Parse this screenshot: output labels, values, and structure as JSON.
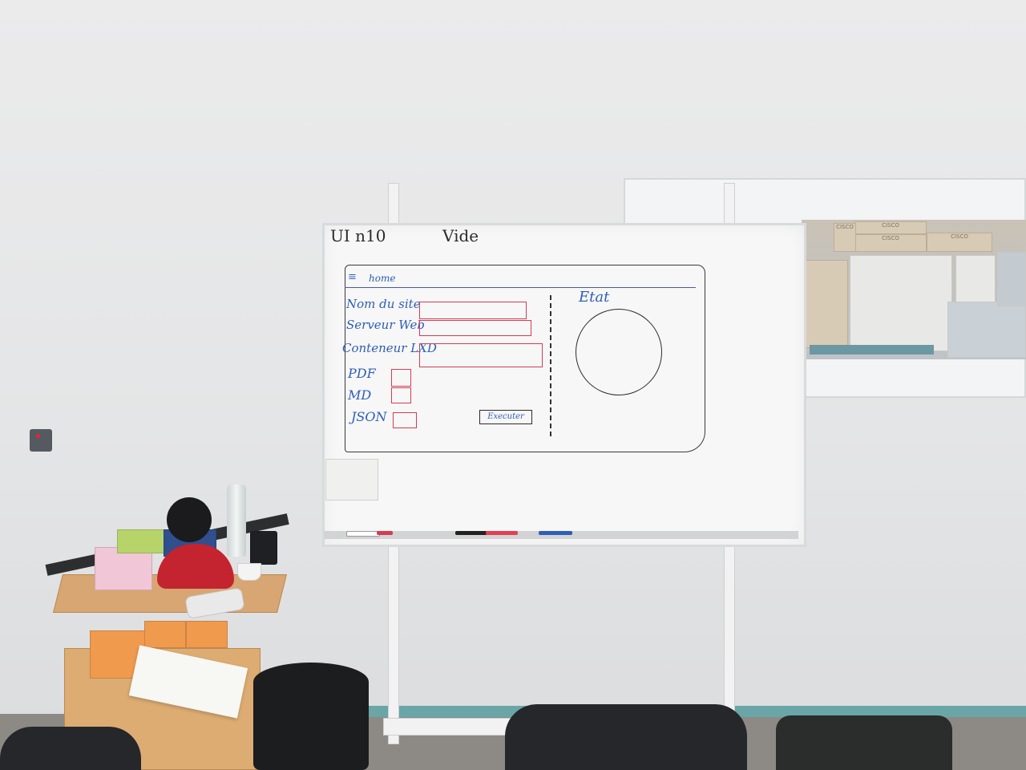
{
  "whiteboard": {
    "title_left": "UI n10",
    "title_right": "Vide",
    "sketch": {
      "menu_label": "home",
      "form_fields": [
        "Nom du site",
        "Serveur Web",
        "Conteneur LXD"
      ],
      "checkbox_labels": [
        "PDF",
        "MD",
        "JSON"
      ],
      "execute_button": "Executer",
      "status_label": "Etat"
    }
  },
  "background": {
    "window_box_labels": [
      "CISCO",
      "CISCO",
      "CISCO",
      "CISCO"
    ]
  },
  "colors": {
    "marker_blue": "#2f5db8",
    "marker_red": "#d43b55",
    "marker_black": "#2b2b2b",
    "baseboard_teal": "#6aa6a8"
  }
}
